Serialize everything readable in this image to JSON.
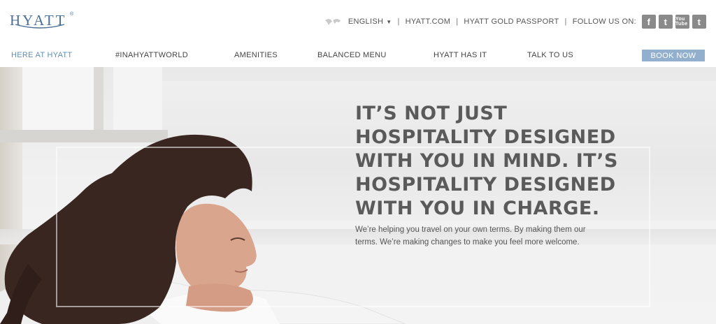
{
  "brand": {
    "logo_text": "HYATT",
    "registered": "®",
    "color": "#4b6f97"
  },
  "utility": {
    "language": "ENGLISH",
    "links": [
      "HYATT.COM",
      "HYATT GOLD PASSPORT"
    ],
    "follow_label": "FOLLOW US ON:",
    "social": [
      {
        "icon": "facebook-icon",
        "glyph": "f"
      },
      {
        "icon": "twitter-icon",
        "glyph": "t"
      },
      {
        "icon": "youtube-icon",
        "glyph": "You Tube"
      },
      {
        "icon": "tumblr-icon",
        "glyph": "t"
      }
    ]
  },
  "nav": {
    "items": [
      {
        "label": "HERE AT HYATT",
        "active": true
      },
      {
        "label": "#INAHYATTWORLD"
      },
      {
        "label": "AMENITIES"
      },
      {
        "label": "BALANCED MENU"
      },
      {
        "label": "HYATT HAS IT"
      },
      {
        "label": "TALK TO US"
      }
    ],
    "book_label": "BOOK NOW",
    "book_color": "#92afcd"
  },
  "hero": {
    "headline": [
      "IT’S NOT JUST",
      "HOSPITALITY DESIGNED",
      "WITH YOU IN MIND. IT’S",
      "HOSPITALITY DESIGNED",
      "WITH YOU IN CHARGE."
    ],
    "subtext": "We’re helping you travel on your own terms. By making them our terms. We’re making changes to make you feel more welcome."
  }
}
